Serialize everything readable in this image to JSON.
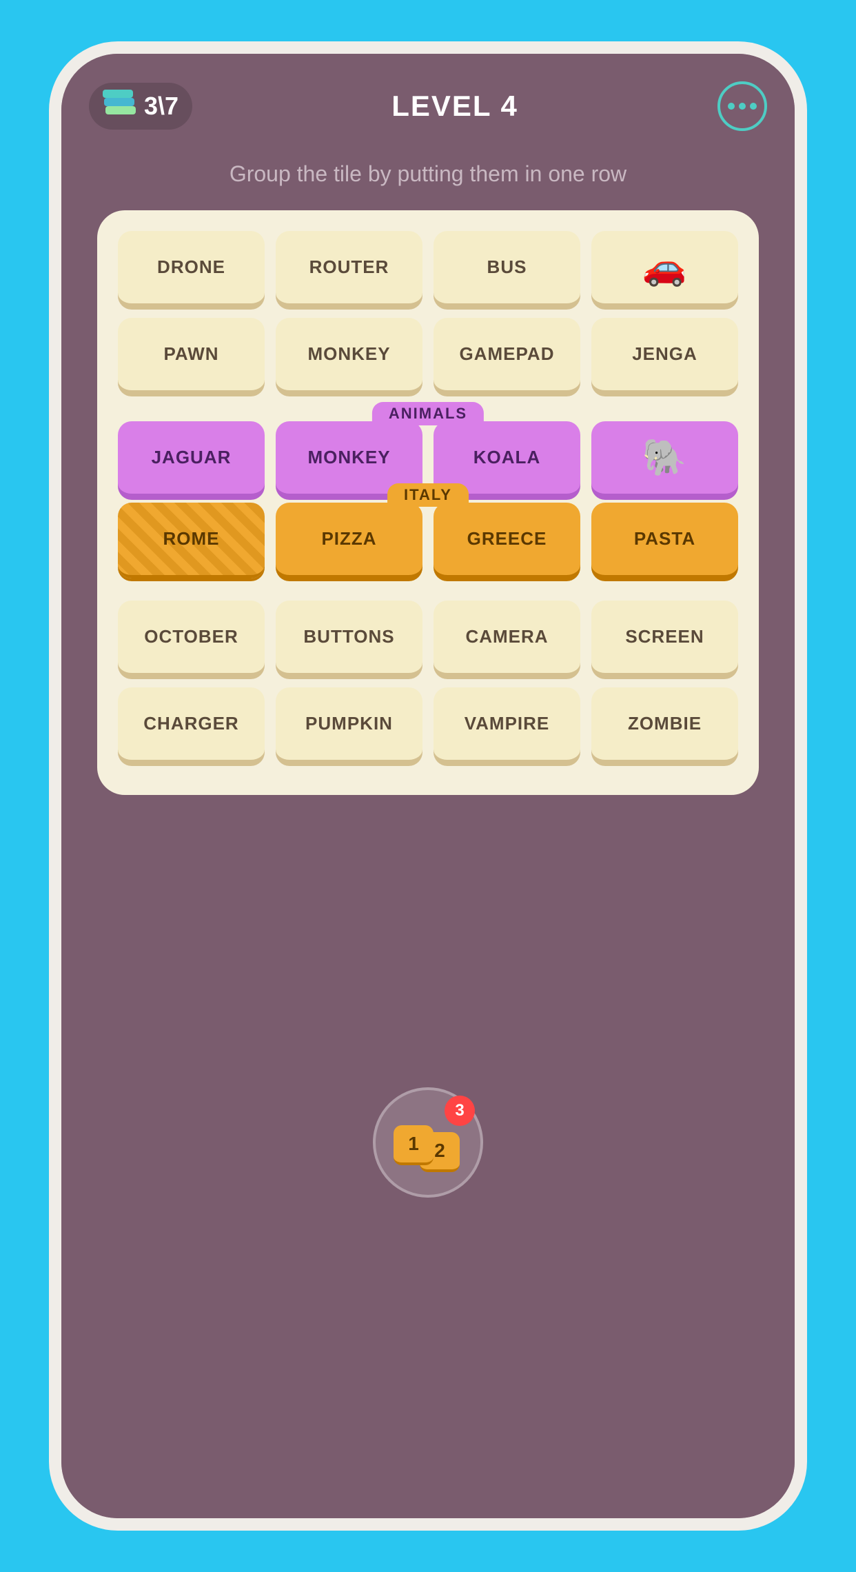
{
  "header": {
    "score": "3\\7",
    "level": "LEVEL 4",
    "menu_label": "menu"
  },
  "instruction": "Group the tile by putting them\nin one row",
  "board": {
    "row1": [
      {
        "text": "DRONE",
        "type": "normal"
      },
      {
        "text": "ROUTER",
        "type": "normal"
      },
      {
        "text": "BUS",
        "type": "normal"
      },
      {
        "text": "🚗",
        "type": "normal",
        "is_icon": true
      }
    ],
    "row2": [
      {
        "text": "PAWN",
        "type": "normal"
      },
      {
        "text": "MONKEY",
        "type": "normal"
      },
      {
        "text": "GAMEPAD",
        "type": "normal"
      },
      {
        "text": "JENGA",
        "type": "normal"
      }
    ],
    "purple_category": "ANIMALS",
    "row3": [
      {
        "text": "JAGUAR",
        "type": "purple"
      },
      {
        "text": "MONKEY",
        "type": "purple"
      },
      {
        "text": "KOALA",
        "type": "purple"
      },
      {
        "text": "🐘",
        "type": "purple",
        "is_icon": true
      }
    ],
    "gold_category": "ITALY",
    "row4": [
      {
        "text": "ROME",
        "type": "gold"
      },
      {
        "text": "PIZZA",
        "type": "gold"
      },
      {
        "text": "GREECE",
        "type": "gold"
      },
      {
        "text": "PASTA",
        "type": "gold"
      }
    ],
    "row5": [
      {
        "text": "OCTOBER",
        "type": "normal"
      },
      {
        "text": "BUTTONS",
        "type": "normal"
      },
      {
        "text": "CAMERA",
        "type": "normal"
      },
      {
        "text": "SCREEN",
        "type": "normal"
      }
    ],
    "row6": [
      {
        "text": "CHARGER",
        "type": "normal"
      },
      {
        "text": "PUMPKIN",
        "type": "normal"
      },
      {
        "text": "VAMPIRE",
        "type": "normal"
      },
      {
        "text": "ZOMBIE",
        "type": "normal"
      }
    ]
  },
  "hint": {
    "tile1": "1",
    "tile2": "2",
    "badge_count": "3"
  }
}
